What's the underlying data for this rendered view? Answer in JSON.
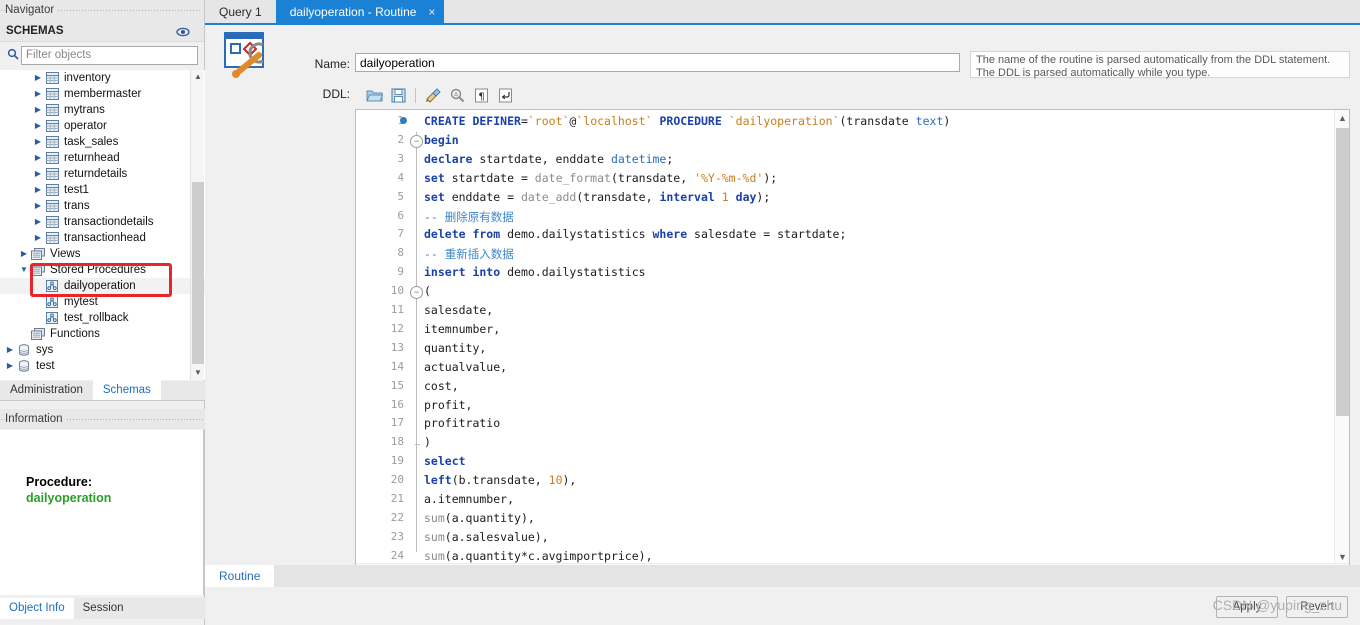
{
  "navigator": {
    "caption": "Navigator",
    "schemas_header": "SCHEMAS",
    "eye_icon": "eye-icon",
    "filter": {
      "icon": "search-icon",
      "placeholder": "Filter objects",
      "value": ""
    },
    "tree": [
      {
        "label": "inventory",
        "type": "table",
        "indent": 2,
        "expander": "collapsed"
      },
      {
        "label": "membermaster",
        "type": "table",
        "indent": 2,
        "expander": "collapsed"
      },
      {
        "label": "mytrans",
        "type": "table",
        "indent": 2,
        "expander": "collapsed"
      },
      {
        "label": "operator",
        "type": "table",
        "indent": 2,
        "expander": "collapsed"
      },
      {
        "label": "task_sales",
        "type": "table",
        "indent": 2,
        "expander": "collapsed"
      },
      {
        "label": "returnhead",
        "type": "table",
        "indent": 2,
        "expander": "collapsed"
      },
      {
        "label": "returndetails",
        "type": "table",
        "indent": 2,
        "expander": "collapsed"
      },
      {
        "label": "test1",
        "type": "table",
        "indent": 2,
        "expander": "collapsed"
      },
      {
        "label": "trans",
        "type": "table",
        "indent": 2,
        "expander": "collapsed"
      },
      {
        "label": "transactiondetails",
        "type": "table",
        "indent": 2,
        "expander": "collapsed"
      },
      {
        "label": "transactionhead",
        "type": "table",
        "indent": 2,
        "expander": "collapsed"
      },
      {
        "label": "Views",
        "type": "folder",
        "indent": 1,
        "expander": "collapsed"
      },
      {
        "label": "Stored Procedures",
        "type": "folder",
        "indent": 1,
        "expander": "expanded"
      },
      {
        "label": "dailyoperation",
        "type": "routine",
        "indent": 2,
        "expander": "none",
        "selected": true
      },
      {
        "label": "mytest",
        "type": "routine",
        "indent": 2,
        "expander": "none"
      },
      {
        "label": "test_rollback",
        "type": "routine",
        "indent": 2,
        "expander": "none"
      },
      {
        "label": "Functions",
        "type": "folder",
        "indent": 1,
        "expander": "none"
      },
      {
        "label": "sys",
        "type": "schema",
        "indent": 0,
        "expander": "collapsed"
      },
      {
        "label": "test",
        "type": "schema",
        "indent": 0,
        "expander": "collapsed"
      }
    ],
    "tabs": [
      {
        "label": "Administration",
        "active": false
      },
      {
        "label": "Schemas",
        "active": true
      }
    ],
    "information": {
      "caption": "Information",
      "title": "Procedure:",
      "name": "dailyoperation",
      "name_color": "#2c9c2c"
    },
    "bottom_tabs": [
      {
        "label": "Object Info",
        "active": true
      },
      {
        "label": "Session",
        "active": false
      }
    ]
  },
  "window_tabs": [
    {
      "label": "Query 1",
      "active": false,
      "closable": false
    },
    {
      "label": "dailyoperation - Routine",
      "active": true,
      "closable": true,
      "close_icon": "close-icon"
    }
  ],
  "editor_header": {
    "routine_icon": "routine-editor-icon",
    "name_label": "Name:",
    "name_value": "dailyoperation",
    "ddl_label": "DDL:",
    "hint": "The name of the routine is parsed automatically from the DDL statement. The DDL is parsed automatically while you type."
  },
  "ddl_toolbar": [
    {
      "name": "open-file-icon",
      "title": "Open"
    },
    {
      "name": "save-file-icon",
      "title": "Save"
    },
    {
      "name": "separator",
      "title": ""
    },
    {
      "name": "beautify-brush-icon",
      "title": "Beautify"
    },
    {
      "name": "find-magnifier-icon",
      "title": "Find"
    },
    {
      "name": "pilcrow-invisible-icon",
      "title": "Toggle invisible characters"
    },
    {
      "name": "wrap-lines-icon",
      "title": "Toggle wrapping"
    }
  ],
  "code": {
    "lines": [
      {
        "n": 1,
        "breakpoint": true,
        "fold": "none",
        "tokens": [
          {
            "t": "kw",
            "v": "CREATE DEFINER"
          },
          {
            "t": "op",
            "v": "="
          },
          {
            "t": "str",
            "v": "`root`"
          },
          {
            "t": "op",
            "v": "@"
          },
          {
            "t": "str",
            "v": "`localhost`"
          },
          {
            "t": "pl",
            "v": " "
          },
          {
            "t": "kw",
            "v": "PROCEDURE"
          },
          {
            "t": "pl",
            "v": " "
          },
          {
            "t": "str",
            "v": "`dailyoperation`"
          },
          {
            "t": "pl",
            "v": "(transdate "
          },
          {
            "t": "kw2",
            "v": "text"
          },
          {
            "t": "pl",
            "v": ")"
          }
        ]
      },
      {
        "n": 2,
        "breakpoint": false,
        "fold": "open",
        "tokens": [
          {
            "t": "kw",
            "v": "begin"
          }
        ]
      },
      {
        "n": 3,
        "breakpoint": false,
        "fold": "none",
        "tokens": [
          {
            "t": "kw",
            "v": "declare"
          },
          {
            "t": "pl",
            "v": " startdate, enddate "
          },
          {
            "t": "kw2",
            "v": "datetime"
          },
          {
            "t": "pl",
            "v": ";"
          }
        ]
      },
      {
        "n": 4,
        "breakpoint": false,
        "fold": "none",
        "tokens": [
          {
            "t": "kw",
            "v": "set"
          },
          {
            "t": "pl",
            "v": " startdate = "
          },
          {
            "t": "fn",
            "v": "date_format"
          },
          {
            "t": "pl",
            "v": "(transdate, "
          },
          {
            "t": "str",
            "v": "'%Y-%m-%d'"
          },
          {
            "t": "pl",
            "v": ");"
          }
        ]
      },
      {
        "n": 5,
        "breakpoint": false,
        "fold": "none",
        "tokens": [
          {
            "t": "kw",
            "v": "set"
          },
          {
            "t": "pl",
            "v": " enddate = "
          },
          {
            "t": "fn",
            "v": "date_add"
          },
          {
            "t": "pl",
            "v": "(transdate, "
          },
          {
            "t": "kw",
            "v": "interval"
          },
          {
            "t": "pl",
            "v": " "
          },
          {
            "t": "num",
            "v": "1"
          },
          {
            "t": "pl",
            "v": " "
          },
          {
            "t": "kw",
            "v": "day"
          },
          {
            "t": "pl",
            "v": ");"
          }
        ]
      },
      {
        "n": 6,
        "breakpoint": false,
        "fold": "none",
        "tokens": [
          {
            "t": "cmt",
            "v": "-- 删除原有数据"
          }
        ]
      },
      {
        "n": 7,
        "breakpoint": false,
        "fold": "none",
        "tokens": [
          {
            "t": "kw",
            "v": "delete from"
          },
          {
            "t": "pl",
            "v": " demo.dailystatistics "
          },
          {
            "t": "kw",
            "v": "where"
          },
          {
            "t": "pl",
            "v": " salesdate = startdate;"
          }
        ]
      },
      {
        "n": 8,
        "breakpoint": false,
        "fold": "none",
        "tokens": [
          {
            "t": "cmt",
            "v": "-- 重新插入数据"
          }
        ]
      },
      {
        "n": 9,
        "breakpoint": false,
        "fold": "none",
        "tokens": [
          {
            "t": "kw",
            "v": "insert into"
          },
          {
            "t": "pl",
            "v": " demo.dailystatistics"
          }
        ]
      },
      {
        "n": 10,
        "breakpoint": false,
        "fold": "open",
        "tokens": [
          {
            "t": "pl",
            "v": "("
          }
        ]
      },
      {
        "n": 11,
        "breakpoint": false,
        "fold": "none",
        "tokens": [
          {
            "t": "pl",
            "v": "salesdate,"
          }
        ]
      },
      {
        "n": 12,
        "breakpoint": false,
        "fold": "none",
        "tokens": [
          {
            "t": "pl",
            "v": "itemnumber,"
          }
        ]
      },
      {
        "n": 13,
        "breakpoint": false,
        "fold": "none",
        "tokens": [
          {
            "t": "pl",
            "v": "quantity,"
          }
        ]
      },
      {
        "n": 14,
        "breakpoint": false,
        "fold": "none",
        "tokens": [
          {
            "t": "pl",
            "v": "actualvalue,"
          }
        ]
      },
      {
        "n": 15,
        "breakpoint": false,
        "fold": "none",
        "tokens": [
          {
            "t": "pl",
            "v": "cost,"
          }
        ]
      },
      {
        "n": 16,
        "breakpoint": false,
        "fold": "none",
        "tokens": [
          {
            "t": "pl",
            "v": "profit,"
          }
        ]
      },
      {
        "n": 17,
        "breakpoint": false,
        "fold": "none",
        "tokens": [
          {
            "t": "pl",
            "v": "profitratio"
          }
        ]
      },
      {
        "n": 18,
        "breakpoint": false,
        "fold": "endmark",
        "tokens": [
          {
            "t": "pl",
            "v": ")"
          }
        ]
      },
      {
        "n": 19,
        "breakpoint": false,
        "fold": "none",
        "tokens": [
          {
            "t": "kw",
            "v": "select"
          }
        ]
      },
      {
        "n": 20,
        "breakpoint": false,
        "fold": "none",
        "tokens": [
          {
            "t": "kw",
            "v": "left"
          },
          {
            "t": "pl",
            "v": "(b.transdate, "
          },
          {
            "t": "num",
            "v": "10"
          },
          {
            "t": "pl",
            "v": "),"
          }
        ]
      },
      {
        "n": 21,
        "breakpoint": false,
        "fold": "none",
        "tokens": [
          {
            "t": "pl",
            "v": "a.itemnumber,"
          }
        ]
      },
      {
        "n": 22,
        "breakpoint": false,
        "fold": "none",
        "tokens": [
          {
            "t": "fn",
            "v": "sum"
          },
          {
            "t": "pl",
            "v": "(a.quantity),"
          }
        ]
      },
      {
        "n": 23,
        "breakpoint": false,
        "fold": "none",
        "tokens": [
          {
            "t": "fn",
            "v": "sum"
          },
          {
            "t": "pl",
            "v": "(a.salesvalue),"
          }
        ]
      },
      {
        "n": 24,
        "breakpoint": false,
        "fold": "none",
        "tokens": [
          {
            "t": "fn",
            "v": "sum"
          },
          {
            "t": "pl",
            "v": "(a.quantity*c.avgimportprice),"
          }
        ]
      }
    ]
  },
  "routine_tabs": [
    {
      "label": "Routine",
      "active": true
    }
  ],
  "footer": {
    "apply_label": "Apply",
    "revert_label": "Revert",
    "watermark": "CSDN @yuping_zhu"
  }
}
